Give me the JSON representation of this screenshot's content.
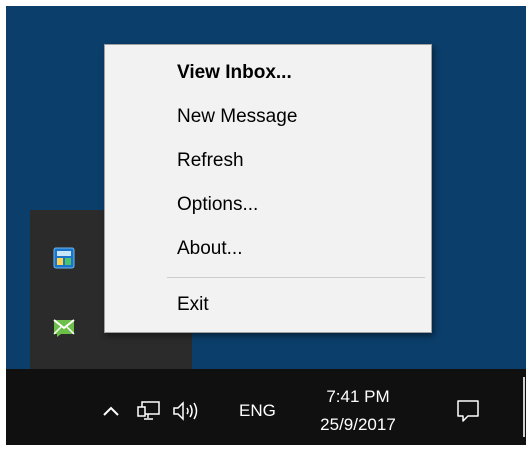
{
  "context_menu": {
    "items": [
      {
        "label": "View Inbox...",
        "default": true
      },
      {
        "label": "New Message"
      },
      {
        "label": "Refresh"
      },
      {
        "label": "Options..."
      },
      {
        "label": "About..."
      },
      {
        "label": "Exit"
      }
    ]
  },
  "tray_overflow": {
    "icons": [
      "app-window-icon",
      "mail-envelope-icon"
    ]
  },
  "taskbar": {
    "icons": [
      "chevron-up-icon",
      "network-icon",
      "volume-icon",
      "action-center-icon"
    ],
    "language": "ENG",
    "clock_time": "7:41 PM",
    "clock_date": "25/9/2017"
  },
  "colors": {
    "desktop": "#0b3e6b",
    "taskbar": "#101010",
    "menu_background": "#f2f2f2",
    "mail_icon": "#6cc04a"
  }
}
